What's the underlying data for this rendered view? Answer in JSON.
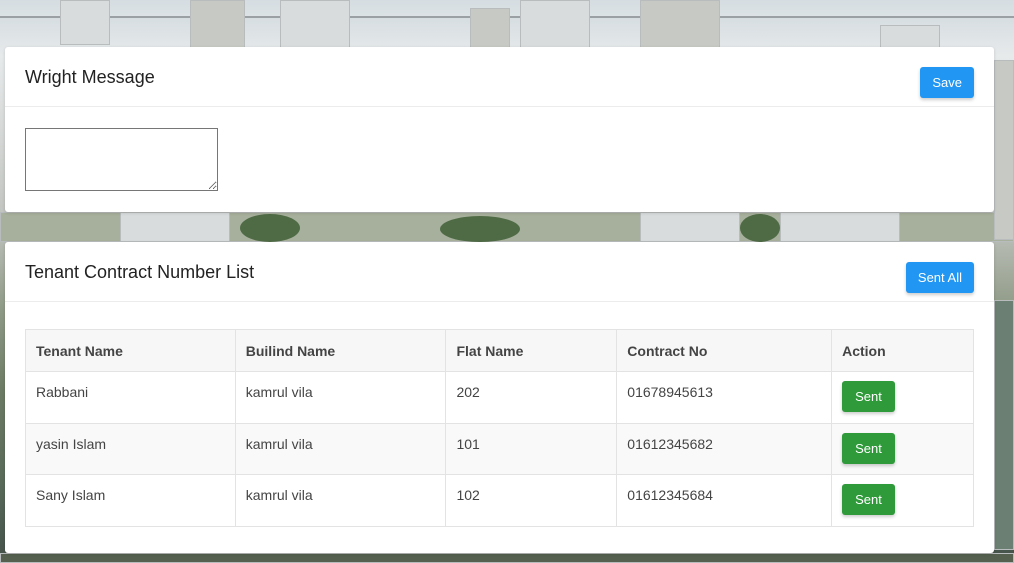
{
  "message_card": {
    "title": "Wright Message",
    "save_label": "Save",
    "message_value": ""
  },
  "list_card": {
    "title": "Tenant Contract Number List",
    "send_all_label": "Sent All",
    "columns": [
      "Tenant Name",
      "Builind Name",
      "Flat Name",
      "Contract No",
      "Action"
    ],
    "rows": [
      {
        "tenant": "Rabbani",
        "building": "kamrul vila",
        "flat": "202",
        "contract": "01678945613",
        "action": "Sent"
      },
      {
        "tenant": "yasin Islam",
        "building": "kamrul vila",
        "flat": "101",
        "contract": "01612345682",
        "action": "Sent"
      },
      {
        "tenant": "Sany Islam",
        "building": "kamrul vila",
        "flat": "102",
        "contract": "01612345684",
        "action": "Sent"
      }
    ]
  },
  "colors": {
    "primary_button": "#2196f3",
    "success_button": "#2e9a3a"
  }
}
